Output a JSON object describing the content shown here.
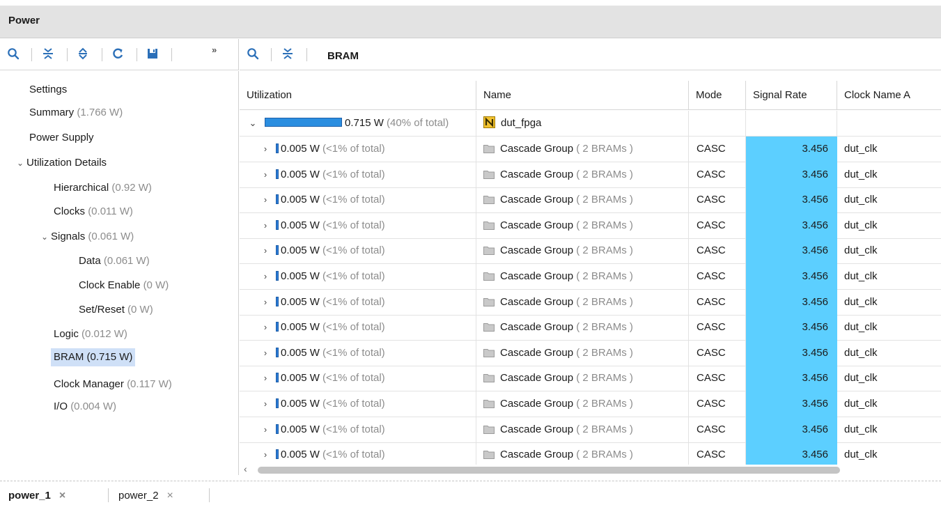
{
  "panel": {
    "title": "Power"
  },
  "left_toolbar": {
    "more": "»"
  },
  "right_toolbar": {
    "title": "BRAM"
  },
  "tree": [
    {
      "label": "Settings"
    },
    {
      "label": "Summary",
      "value": "(1.766 W)"
    },
    {
      "label": "Power Supply"
    },
    {
      "label": "Utilization Details",
      "expanded": true
    },
    {
      "label": "Hierarchical",
      "value": "(0.92 W)"
    },
    {
      "label": "Clocks",
      "value": "(0.011 W)"
    },
    {
      "label": "Signals",
      "value": "(0.061 W)",
      "expanded": true
    },
    {
      "label": "Data",
      "value": "(0.061 W)"
    },
    {
      "label": "Clock Enable",
      "value": "(0 W)"
    },
    {
      "label": "Set/Reset",
      "value": "(0 W)"
    },
    {
      "label": "Logic",
      "value": "(0.012 W)"
    },
    {
      "label": "BRAM (0.715 W)",
      "selected": true
    },
    {
      "label": "Clock Manager",
      "value": "(0.117 W)"
    },
    {
      "label": "I/O",
      "value": "(0.004 W)"
    }
  ],
  "table": {
    "headers": [
      "Utilization",
      "Name",
      "Mode",
      "Signal Rate",
      "Clock Name A"
    ],
    "root": {
      "expander": "⌄",
      "value": "0.715 W",
      "pct": "(40% of total)",
      "name": "dut_fpga",
      "fill_fraction": 1.0
    },
    "rows": [
      {
        "value": "0.005 W",
        "pct": "(<1% of total)",
        "name": "Cascade Group",
        "detail": "( 2 BRAMs )",
        "mode": "CASC",
        "rate": "3.456",
        "clock": "dut_clk"
      },
      {
        "value": "0.005 W",
        "pct": "(<1% of total)",
        "name": "Cascade Group",
        "detail": "( 2 BRAMs )",
        "mode": "CASC",
        "rate": "3.456",
        "clock": "dut_clk"
      },
      {
        "value": "0.005 W",
        "pct": "(<1% of total)",
        "name": "Cascade Group",
        "detail": "( 2 BRAMs )",
        "mode": "CASC",
        "rate": "3.456",
        "clock": "dut_clk"
      },
      {
        "value": "0.005 W",
        "pct": "(<1% of total)",
        "name": "Cascade Group",
        "detail": "( 2 BRAMs )",
        "mode": "CASC",
        "rate": "3.456",
        "clock": "dut_clk"
      },
      {
        "value": "0.005 W",
        "pct": "(<1% of total)",
        "name": "Cascade Group",
        "detail": "( 2 BRAMs )",
        "mode": "CASC",
        "rate": "3.456",
        "clock": "dut_clk"
      },
      {
        "value": "0.005 W",
        "pct": "(<1% of total)",
        "name": "Cascade Group",
        "detail": "( 2 BRAMs )",
        "mode": "CASC",
        "rate": "3.456",
        "clock": "dut_clk"
      },
      {
        "value": "0.005 W",
        "pct": "(<1% of total)",
        "name": "Cascade Group",
        "detail": "( 2 BRAMs )",
        "mode": "CASC",
        "rate": "3.456",
        "clock": "dut_clk"
      },
      {
        "value": "0.005 W",
        "pct": "(<1% of total)",
        "name": "Cascade Group",
        "detail": "( 2 BRAMs )",
        "mode": "CASC",
        "rate": "3.456",
        "clock": "dut_clk"
      },
      {
        "value": "0.005 W",
        "pct": "(<1% of total)",
        "name": "Cascade Group",
        "detail": "( 2 BRAMs )",
        "mode": "CASC",
        "rate": "3.456",
        "clock": "dut_clk"
      },
      {
        "value": "0.005 W",
        "pct": "(<1% of total)",
        "name": "Cascade Group",
        "detail": "( 2 BRAMs )",
        "mode": "CASC",
        "rate": "3.456",
        "clock": "dut_clk"
      },
      {
        "value": "0.005 W",
        "pct": "(<1% of total)",
        "name": "Cascade Group",
        "detail": "( 2 BRAMs )",
        "mode": "CASC",
        "rate": "3.456",
        "clock": "dut_clk"
      },
      {
        "value": "0.005 W",
        "pct": "(<1% of total)",
        "name": "Cascade Group",
        "detail": "( 2 BRAMs )",
        "mode": "CASC",
        "rate": "3.456",
        "clock": "dut_clk"
      },
      {
        "value": "0.005 W",
        "pct": "(<1% of total)",
        "name": "Cascade Group",
        "detail": "( 2 BRAMs )",
        "mode": "CASC",
        "rate": "3.456",
        "clock": "dut_clk"
      }
    ],
    "row_expander": "›",
    "highlight_color": "#5ccfff"
  },
  "scrollbar": {
    "left_arrow": "‹"
  },
  "tabs": [
    {
      "label": "power_1",
      "active": true,
      "close": "×"
    },
    {
      "label": "power_2",
      "active": false,
      "close": "×"
    }
  ]
}
